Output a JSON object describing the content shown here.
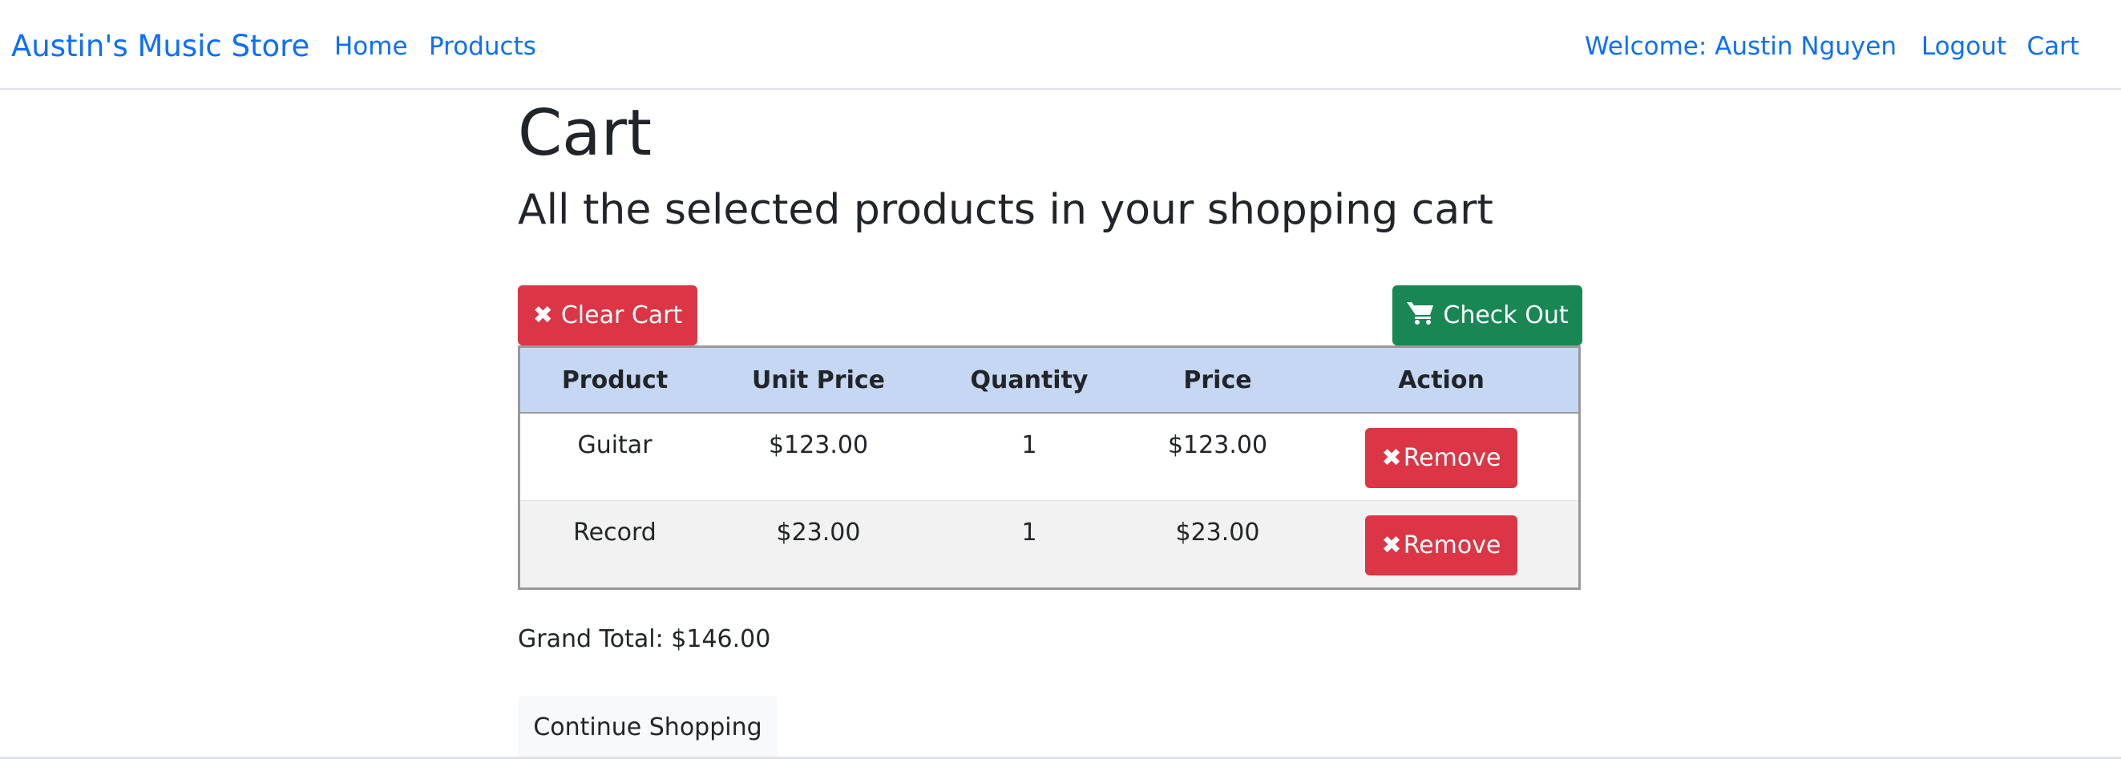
{
  "navbar": {
    "brand": "Austin's Music Store",
    "links": [
      "Home",
      "Products"
    ],
    "welcome": "Welcome: Austin Nguyen",
    "logout": "Logout",
    "cart": "Cart"
  },
  "page": {
    "title": "Cart",
    "subtitle": "All the selected products in your shopping cart"
  },
  "actions": {
    "clear_cart": "Clear Cart",
    "check_out": "Check Out",
    "clear_icon": "times-icon",
    "checkout_icon": "shopping-cart-icon"
  },
  "table": {
    "headers": [
      "Product",
      "Unit Price",
      "Quantity",
      "Price",
      "Action"
    ],
    "rows": [
      {
        "product": "Guitar",
        "unit_price": "$123.00",
        "quantity": "1",
        "price": "$123.00",
        "action": "Remove"
      },
      {
        "product": "Record",
        "unit_price": "$23.00",
        "quantity": "1",
        "price": "$23.00",
        "action": "Remove"
      }
    ]
  },
  "summary": {
    "grand_total": "Grand Total: $146.00",
    "continue_shopping": "Continue Shopping"
  },
  "colors": {
    "link": "#0d6efd",
    "danger": "#dc3545",
    "success": "#198754",
    "table_header": "#c5d7f2"
  }
}
